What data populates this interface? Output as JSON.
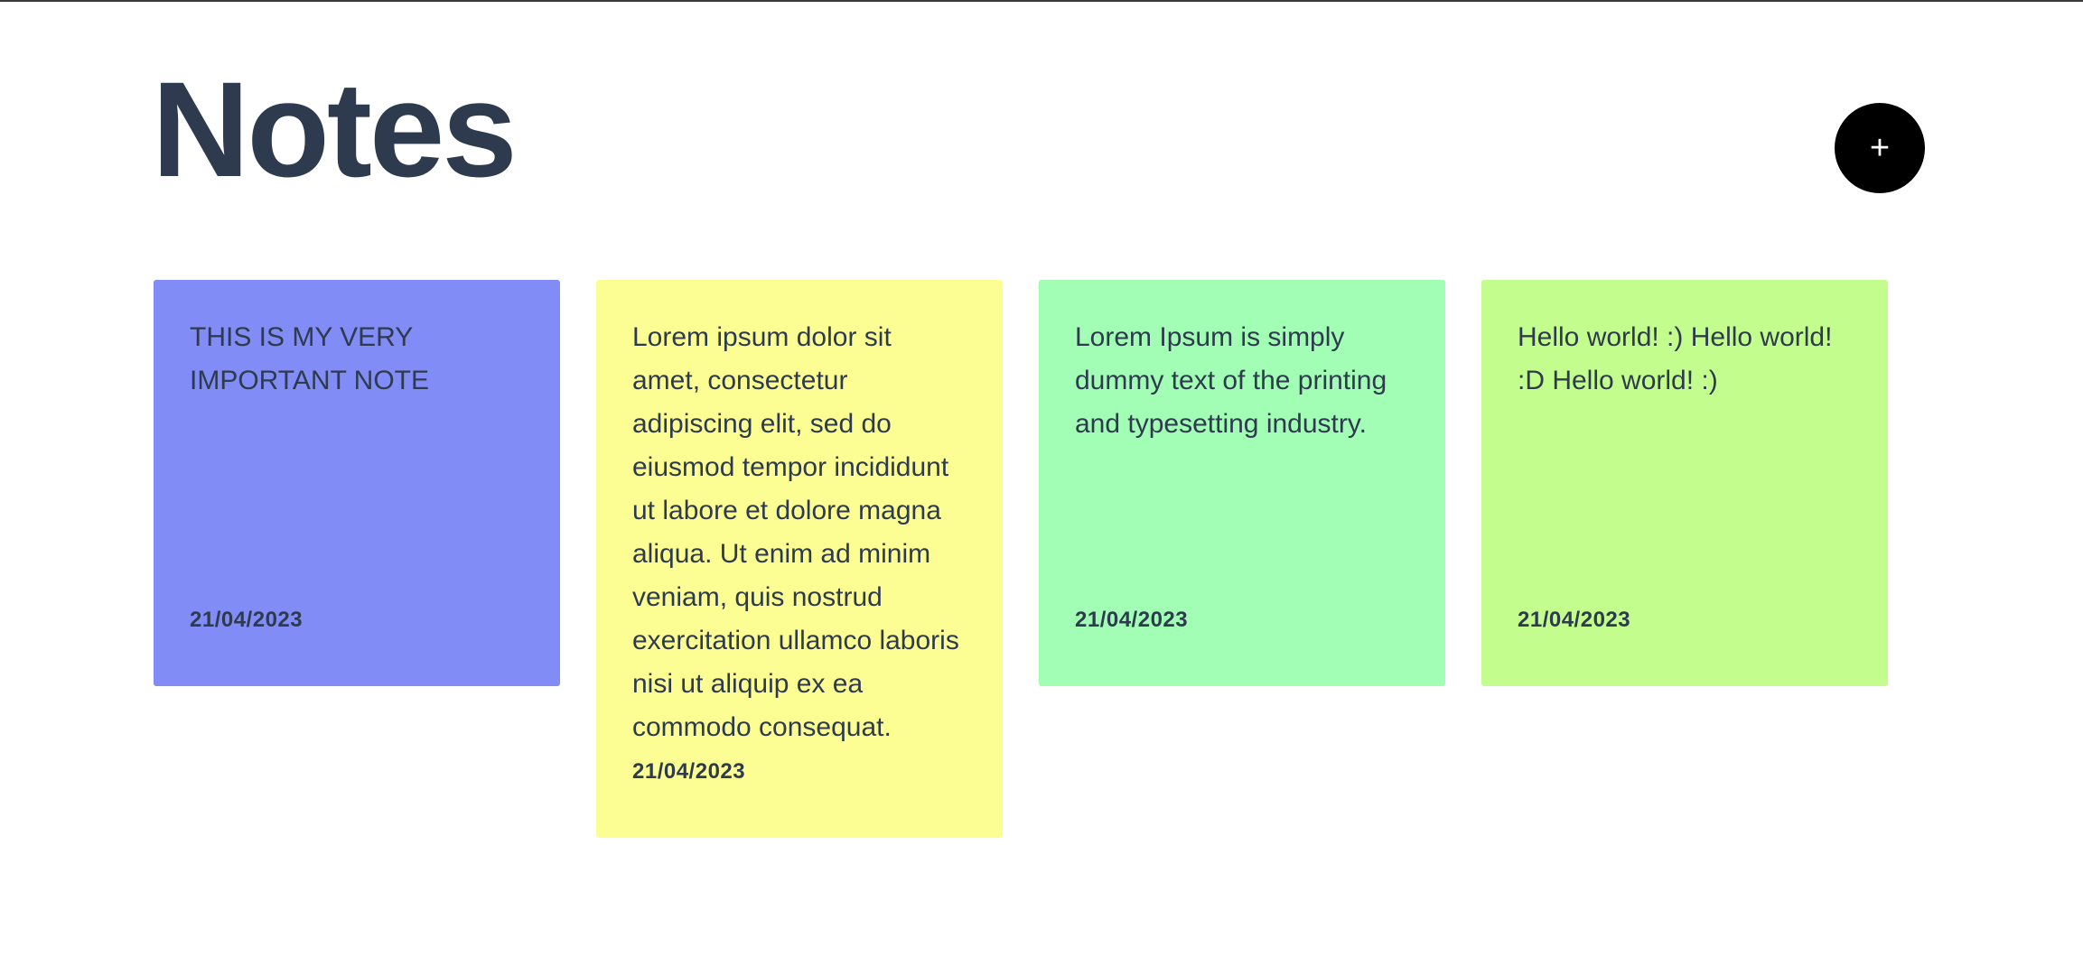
{
  "header": {
    "title": "Notes",
    "add_button_icon": "plus-icon",
    "add_button_glyph": "+"
  },
  "notes": [
    {
      "text": "THIS IS MY VERY IMPORTANT NOTE",
      "date": "21/04/2023",
      "color": "#828cf6"
    },
    {
      "text": "Lorem ipsum dolor sit amet, consectetur adipiscing elit, sed do eiusmod tempor incididunt ut labore et dolore magna aliqua. Ut enim ad minim veniam, quis nostrud exercitation ullamco laboris nisi ut aliquip ex ea commodo consequat.",
      "date": "21/04/2023",
      "color": "#fcfd92"
    },
    {
      "text": "Lorem Ipsum is simply dummy text of the printing and typesetting industry.",
      "date": "21/04/2023",
      "color": "#a2fdb5"
    },
    {
      "text": "Hello world! :) Hello world! :D Hello world! :)",
      "date": "21/04/2023",
      "color": "#c3fd8e"
    }
  ]
}
